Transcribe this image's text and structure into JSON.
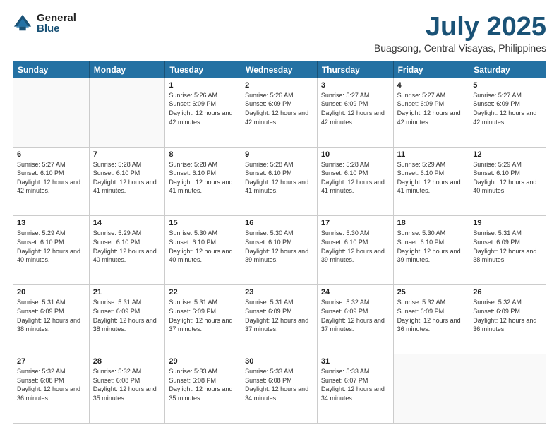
{
  "logo": {
    "general": "General",
    "blue": "Blue"
  },
  "header": {
    "month": "July 2025",
    "location": "Buagsong, Central Visayas, Philippines"
  },
  "days": [
    "Sunday",
    "Monday",
    "Tuesday",
    "Wednesday",
    "Thursday",
    "Friday",
    "Saturday"
  ],
  "weeks": [
    [
      {
        "day": "",
        "info": ""
      },
      {
        "day": "",
        "info": ""
      },
      {
        "day": "1",
        "info": "Sunrise: 5:26 AM\nSunset: 6:09 PM\nDaylight: 12 hours and 42 minutes."
      },
      {
        "day": "2",
        "info": "Sunrise: 5:26 AM\nSunset: 6:09 PM\nDaylight: 12 hours and 42 minutes."
      },
      {
        "day": "3",
        "info": "Sunrise: 5:27 AM\nSunset: 6:09 PM\nDaylight: 12 hours and 42 minutes."
      },
      {
        "day": "4",
        "info": "Sunrise: 5:27 AM\nSunset: 6:09 PM\nDaylight: 12 hours and 42 minutes."
      },
      {
        "day": "5",
        "info": "Sunrise: 5:27 AM\nSunset: 6:09 PM\nDaylight: 12 hours and 42 minutes."
      }
    ],
    [
      {
        "day": "6",
        "info": "Sunrise: 5:27 AM\nSunset: 6:10 PM\nDaylight: 12 hours and 42 minutes."
      },
      {
        "day": "7",
        "info": "Sunrise: 5:28 AM\nSunset: 6:10 PM\nDaylight: 12 hours and 41 minutes."
      },
      {
        "day": "8",
        "info": "Sunrise: 5:28 AM\nSunset: 6:10 PM\nDaylight: 12 hours and 41 minutes."
      },
      {
        "day": "9",
        "info": "Sunrise: 5:28 AM\nSunset: 6:10 PM\nDaylight: 12 hours and 41 minutes."
      },
      {
        "day": "10",
        "info": "Sunrise: 5:28 AM\nSunset: 6:10 PM\nDaylight: 12 hours and 41 minutes."
      },
      {
        "day": "11",
        "info": "Sunrise: 5:29 AM\nSunset: 6:10 PM\nDaylight: 12 hours and 41 minutes."
      },
      {
        "day": "12",
        "info": "Sunrise: 5:29 AM\nSunset: 6:10 PM\nDaylight: 12 hours and 40 minutes."
      }
    ],
    [
      {
        "day": "13",
        "info": "Sunrise: 5:29 AM\nSunset: 6:10 PM\nDaylight: 12 hours and 40 minutes."
      },
      {
        "day": "14",
        "info": "Sunrise: 5:29 AM\nSunset: 6:10 PM\nDaylight: 12 hours and 40 minutes."
      },
      {
        "day": "15",
        "info": "Sunrise: 5:30 AM\nSunset: 6:10 PM\nDaylight: 12 hours and 40 minutes."
      },
      {
        "day": "16",
        "info": "Sunrise: 5:30 AM\nSunset: 6:10 PM\nDaylight: 12 hours and 39 minutes."
      },
      {
        "day": "17",
        "info": "Sunrise: 5:30 AM\nSunset: 6:10 PM\nDaylight: 12 hours and 39 minutes."
      },
      {
        "day": "18",
        "info": "Sunrise: 5:30 AM\nSunset: 6:10 PM\nDaylight: 12 hours and 39 minutes."
      },
      {
        "day": "19",
        "info": "Sunrise: 5:31 AM\nSunset: 6:09 PM\nDaylight: 12 hours and 38 minutes."
      }
    ],
    [
      {
        "day": "20",
        "info": "Sunrise: 5:31 AM\nSunset: 6:09 PM\nDaylight: 12 hours and 38 minutes."
      },
      {
        "day": "21",
        "info": "Sunrise: 5:31 AM\nSunset: 6:09 PM\nDaylight: 12 hours and 38 minutes."
      },
      {
        "day": "22",
        "info": "Sunrise: 5:31 AM\nSunset: 6:09 PM\nDaylight: 12 hours and 37 minutes."
      },
      {
        "day": "23",
        "info": "Sunrise: 5:31 AM\nSunset: 6:09 PM\nDaylight: 12 hours and 37 minutes."
      },
      {
        "day": "24",
        "info": "Sunrise: 5:32 AM\nSunset: 6:09 PM\nDaylight: 12 hours and 37 minutes."
      },
      {
        "day": "25",
        "info": "Sunrise: 5:32 AM\nSunset: 6:09 PM\nDaylight: 12 hours and 36 minutes."
      },
      {
        "day": "26",
        "info": "Sunrise: 5:32 AM\nSunset: 6:09 PM\nDaylight: 12 hours and 36 minutes."
      }
    ],
    [
      {
        "day": "27",
        "info": "Sunrise: 5:32 AM\nSunset: 6:08 PM\nDaylight: 12 hours and 36 minutes."
      },
      {
        "day": "28",
        "info": "Sunrise: 5:32 AM\nSunset: 6:08 PM\nDaylight: 12 hours and 35 minutes."
      },
      {
        "day": "29",
        "info": "Sunrise: 5:33 AM\nSunset: 6:08 PM\nDaylight: 12 hours and 35 minutes."
      },
      {
        "day": "30",
        "info": "Sunrise: 5:33 AM\nSunset: 6:08 PM\nDaylight: 12 hours and 34 minutes."
      },
      {
        "day": "31",
        "info": "Sunrise: 5:33 AM\nSunset: 6:07 PM\nDaylight: 12 hours and 34 minutes."
      },
      {
        "day": "",
        "info": ""
      },
      {
        "day": "",
        "info": ""
      }
    ]
  ]
}
